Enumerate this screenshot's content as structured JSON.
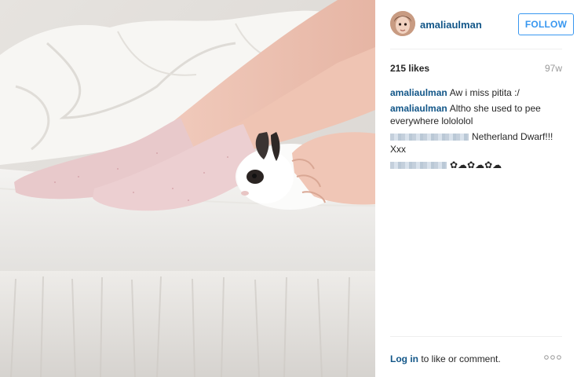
{
  "post": {
    "username": "amaliaulman",
    "follow_label": "FOLLOW",
    "likes": "215 likes",
    "age": "97w",
    "comments": [
      {
        "author": "amaliaulman",
        "text": "Aw i miss pitita :/"
      },
      {
        "author": "amaliaulman",
        "text": "Altho she used to pee everywhere lolololol"
      },
      {
        "author": "",
        "text": "Netherland Dwarf!!! Xxx"
      },
      {
        "author": "",
        "text": "✿☁✿☁✿☁"
      }
    ],
    "login_link": "Log in",
    "login_rest": " to like or comment."
  },
  "colors": {
    "link": "#125688",
    "follow_blue": "#3897f0",
    "muted": "#999999"
  },
  "icons": {
    "more": "more-options-icon"
  }
}
